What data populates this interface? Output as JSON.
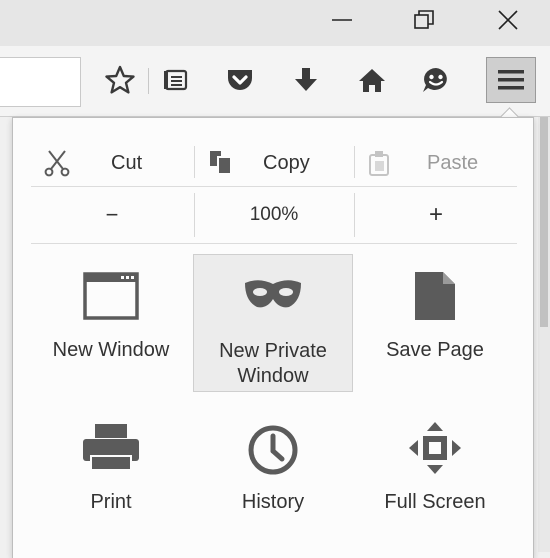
{
  "window": {
    "controls": [
      {
        "name": "minimize-icon"
      },
      {
        "name": "restore-icon"
      },
      {
        "name": "close-icon"
      }
    ]
  },
  "toolbar": {
    "buttons": [
      {
        "name": "bookmark-star-icon"
      },
      {
        "name": "reading-list-icon"
      },
      {
        "name": "pocket-icon"
      },
      {
        "name": "downloads-icon"
      },
      {
        "name": "home-icon"
      },
      {
        "name": "hello-smiley-icon"
      }
    ],
    "menu_button_icon": "hamburger-menu-icon"
  },
  "menu": {
    "edit": {
      "cut": "Cut",
      "copy": "Copy",
      "paste": "Paste"
    },
    "zoom": {
      "out": "−",
      "level": "100%",
      "in": "+"
    },
    "items": [
      {
        "label": "New Window",
        "icon": "new-window-icon"
      },
      {
        "label": "New Private\nWindow",
        "icon": "private-mask-icon",
        "active": true
      },
      {
        "label": "Save Page",
        "icon": "page-icon"
      },
      {
        "label": "Print",
        "icon": "printer-icon"
      },
      {
        "label": "History",
        "icon": "clock-icon"
      },
      {
        "label": "Full Screen",
        "icon": "fullscreen-arrows-icon"
      }
    ]
  },
  "colors": {
    "icon": "#5b5b5b",
    "panel_bg": "#fcfcfc",
    "active_bg": "#ececec"
  }
}
